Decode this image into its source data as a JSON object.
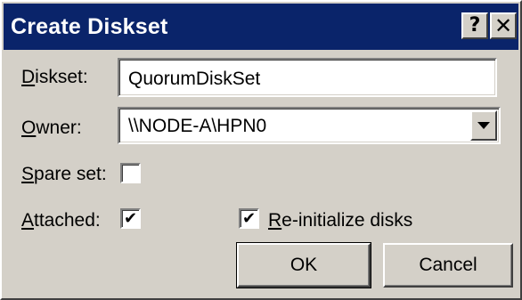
{
  "window": {
    "title": "Create Diskset",
    "help_label": "?",
    "close_label": "✕"
  },
  "form": {
    "diskset_label_first": "D",
    "diskset_label_rest": "iskset:",
    "diskset_value": "QuorumDiskSet",
    "owner_label_first": "O",
    "owner_label_rest": "wner:",
    "owner_value": "\\\\NODE-A\\HPN0",
    "spare_label_first": "S",
    "spare_label_rest": "pare set:",
    "spare_checked": false,
    "attached_label_first": "A",
    "attached_label_rest": "ttached:",
    "attached_checked": true,
    "reinit_label_first": "R",
    "reinit_label_rest": "e-initialize disks",
    "reinit_checked": true
  },
  "buttons": {
    "ok_label": "OK",
    "cancel_label": "Cancel"
  },
  "icons": {
    "dropdown": "chevron-down-icon",
    "check": "checkmark-icon"
  },
  "colors": {
    "titlebar": "#0a246a",
    "face": "#d4d0c8"
  }
}
